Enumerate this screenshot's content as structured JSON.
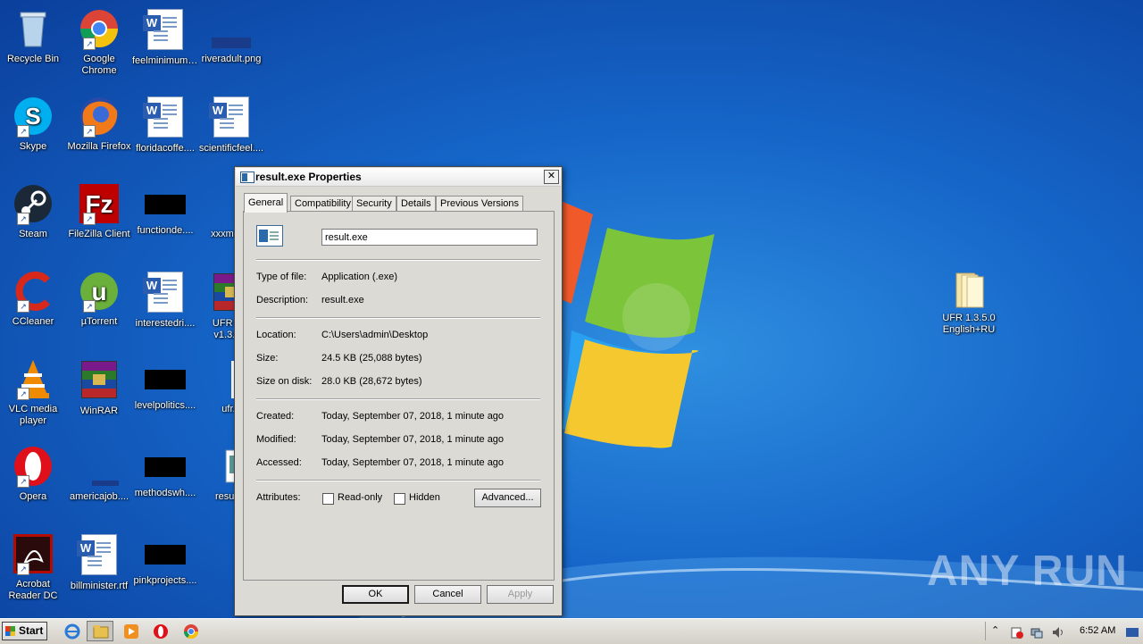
{
  "desktop": {
    "icons": [
      {
        "label": "Recycle Bin",
        "icon": "recycle-bin-icon"
      },
      {
        "label": "Google Chrome",
        "icon": "chrome-icon"
      },
      {
        "label": "feelminimum....",
        "icon": "word-doc-icon"
      },
      {
        "label": "riveradult.png",
        "icon": "png-file-icon"
      },
      {
        "label": "Skype",
        "icon": "skype-icon"
      },
      {
        "label": "Mozilla Firefox",
        "icon": "firefox-icon"
      },
      {
        "label": "floridacoffe....",
        "icon": "word-doc-icon"
      },
      {
        "label": "scientificfeel....",
        "icon": "word-doc-icon"
      },
      {
        "label": "Steam",
        "icon": "steam-icon"
      },
      {
        "label": "FileZilla Client",
        "icon": "filezilla-icon"
      },
      {
        "label": "functionde....",
        "icon": "file-icon"
      },
      {
        "label": "xxxmov...",
        "icon": "file-icon"
      },
      {
        "label": "CCleaner",
        "icon": "ccleaner-icon"
      },
      {
        "label": "µTorrent",
        "icon": "utorrent-icon"
      },
      {
        "label": "interestedri....",
        "icon": "word-doc-icon"
      },
      {
        "label": "UFR S... v1.3.5...",
        "icon": "winrar-archive-icon"
      },
      {
        "label": "VLC media player",
        "icon": "vlc-icon"
      },
      {
        "label": "WinRAR",
        "icon": "winrar-icon"
      },
      {
        "label": "levelpolitics....",
        "icon": "file-icon"
      },
      {
        "label": "ufr...",
        "icon": "file-icon"
      },
      {
        "label": "Opera",
        "icon": "opera-icon"
      },
      {
        "label": "americajob....",
        "icon": "file-icon"
      },
      {
        "label": "methodswh....",
        "icon": "file-icon"
      },
      {
        "label": "result...",
        "icon": "exe-icon"
      },
      {
        "label": "Acrobat Reader DC",
        "icon": "acrobat-icon"
      },
      {
        "label": "billminister.rtf",
        "icon": "word-doc-icon"
      },
      {
        "label": "pinkprojects....",
        "icon": "file-icon"
      },
      {
        "label": "UFR 1.3.5.0 English+RU",
        "icon": "folder-icon"
      }
    ]
  },
  "dialog": {
    "title": "result.exe Properties",
    "close": "✕",
    "tabs": [
      "General",
      "Compatibility",
      "Security",
      "Details",
      "Previous Versions"
    ],
    "active_tab": "General",
    "filename": "result.exe",
    "type_label": "Type of file:",
    "type_value": "Application (.exe)",
    "desc_label": "Description:",
    "desc_value": "result.exe",
    "location_label": "Location:",
    "location_value": "C:\\Users\\admin\\Desktop",
    "size_label": "Size:",
    "size_value": "24.5 KB (25,088 bytes)",
    "sizedisk_label": "Size on disk:",
    "sizedisk_value": "28.0 KB (28,672 bytes)",
    "created_label": "Created:",
    "created_value": "Today, September 07, 2018, 1 minute ago",
    "modified_label": "Modified:",
    "modified_value": "Today, September 07, 2018, 1 minute ago",
    "accessed_label": "Accessed:",
    "accessed_value": "Today, September 07, 2018, 1 minute ago",
    "attributes_label": "Attributes:",
    "readonly_label": "Read-only",
    "readonly_checked": false,
    "hidden_label": "Hidden",
    "hidden_checked": false,
    "advanced_label": "Advanced...",
    "ok_label": "OK",
    "cancel_label": "Cancel",
    "apply_label": "Apply"
  },
  "taskbar": {
    "start_label": "Start",
    "pinned": [
      "ie-icon",
      "explorer-icon",
      "media-player-icon",
      "opera-icon",
      "chrome-icon"
    ],
    "clock": "6:52 AM"
  },
  "watermark": "ANY RUN"
}
